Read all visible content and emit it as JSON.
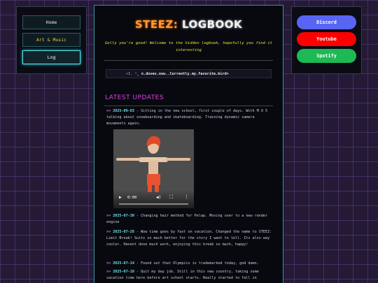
{
  "nav": {
    "items": [
      {
        "label": "Home",
        "color": "#e8e8e8"
      },
      {
        "label": "Art & Music",
        "color": "#e8d04a"
      },
      {
        "label": "Log",
        "color": "#ffffff"
      }
    ]
  },
  "socials": [
    {
      "label": "Discord",
      "color": "#5865f2"
    },
    {
      "label": "Youtube",
      "color": "#ff0000"
    },
    {
      "label": "Spotify",
      "color": "#1db954"
    }
  ],
  "header": {
    "title_part1": "STEEZ:",
    "title_part2": "LOGBOOK",
    "intro": "Golly you're good! Welcome to the hidden logbook, hopefully you find it interesting"
  },
  "code": {
    "prefix": ">I.",
    "mid": "n.doves.now..Currently.my.favorite.bird>"
  },
  "updates": {
    "heading": "LATEST UPDATES",
    "arrow": ">>",
    "entries": [
      {
        "date": "2025-09-03",
        "text": " - Sitting in the new school, first couple of days. With M O 5 talking about snowboarding and skateboarding. Training dynamic camera movements again."
      },
      {
        "date": "2025-07-30",
        "text": " - Changing hair method for Pelap. Moving over to a new render engine"
      },
      {
        "date": "2025-07-28",
        "text": " - Wow time goes by fast on vacation. Changed the name to STEEZ: Limit Break! Suits so much better for the story I want to tell. Its also way cooler. Havent done much work, enjoying this break so much, happy!"
      },
      {
        "date": "2025-07-14",
        "text": " - Found out that Olympics is trademarked today, god damn."
      },
      {
        "date": "2025-07-10",
        "text": " - Quit my day job. Still in this new country, taking some vacation time here before art school starts. Really started to fall in"
      }
    ]
  },
  "video": {
    "time": "0:00"
  }
}
